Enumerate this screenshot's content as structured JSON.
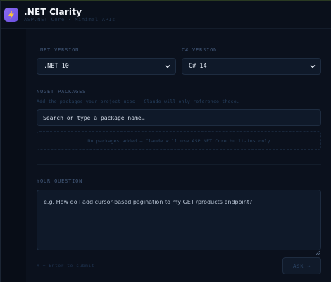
{
  "app": {
    "title": ".NET Clarity",
    "subtitle": "ASP.NET Core · Minimal APIs",
    "logo_icon": "lightning-bolt-icon",
    "accent": "#7b5cf0"
  },
  "version": {
    "dotnet_label": ".NET VERSION",
    "dotnet_selected": ".NET 10",
    "csharp_label": "C# VERSION",
    "csharp_selected": "C# 14"
  },
  "packages": {
    "label": "NUGET PACKAGES",
    "hint": "Add the packages your project uses — Claude will only reference these.",
    "placeholder": "Search or type a package name…",
    "empty_text": "No packages added — Claude will use ASP.NET Core built-ins only"
  },
  "question": {
    "label": "YOUR QUESTION",
    "placeholder": "e.g. How do I add cursor-based pagination to my GET /products endpoint?"
  },
  "footer": {
    "shortcut": "⌘ + Enter to submit",
    "ask_label": "Ask →"
  }
}
